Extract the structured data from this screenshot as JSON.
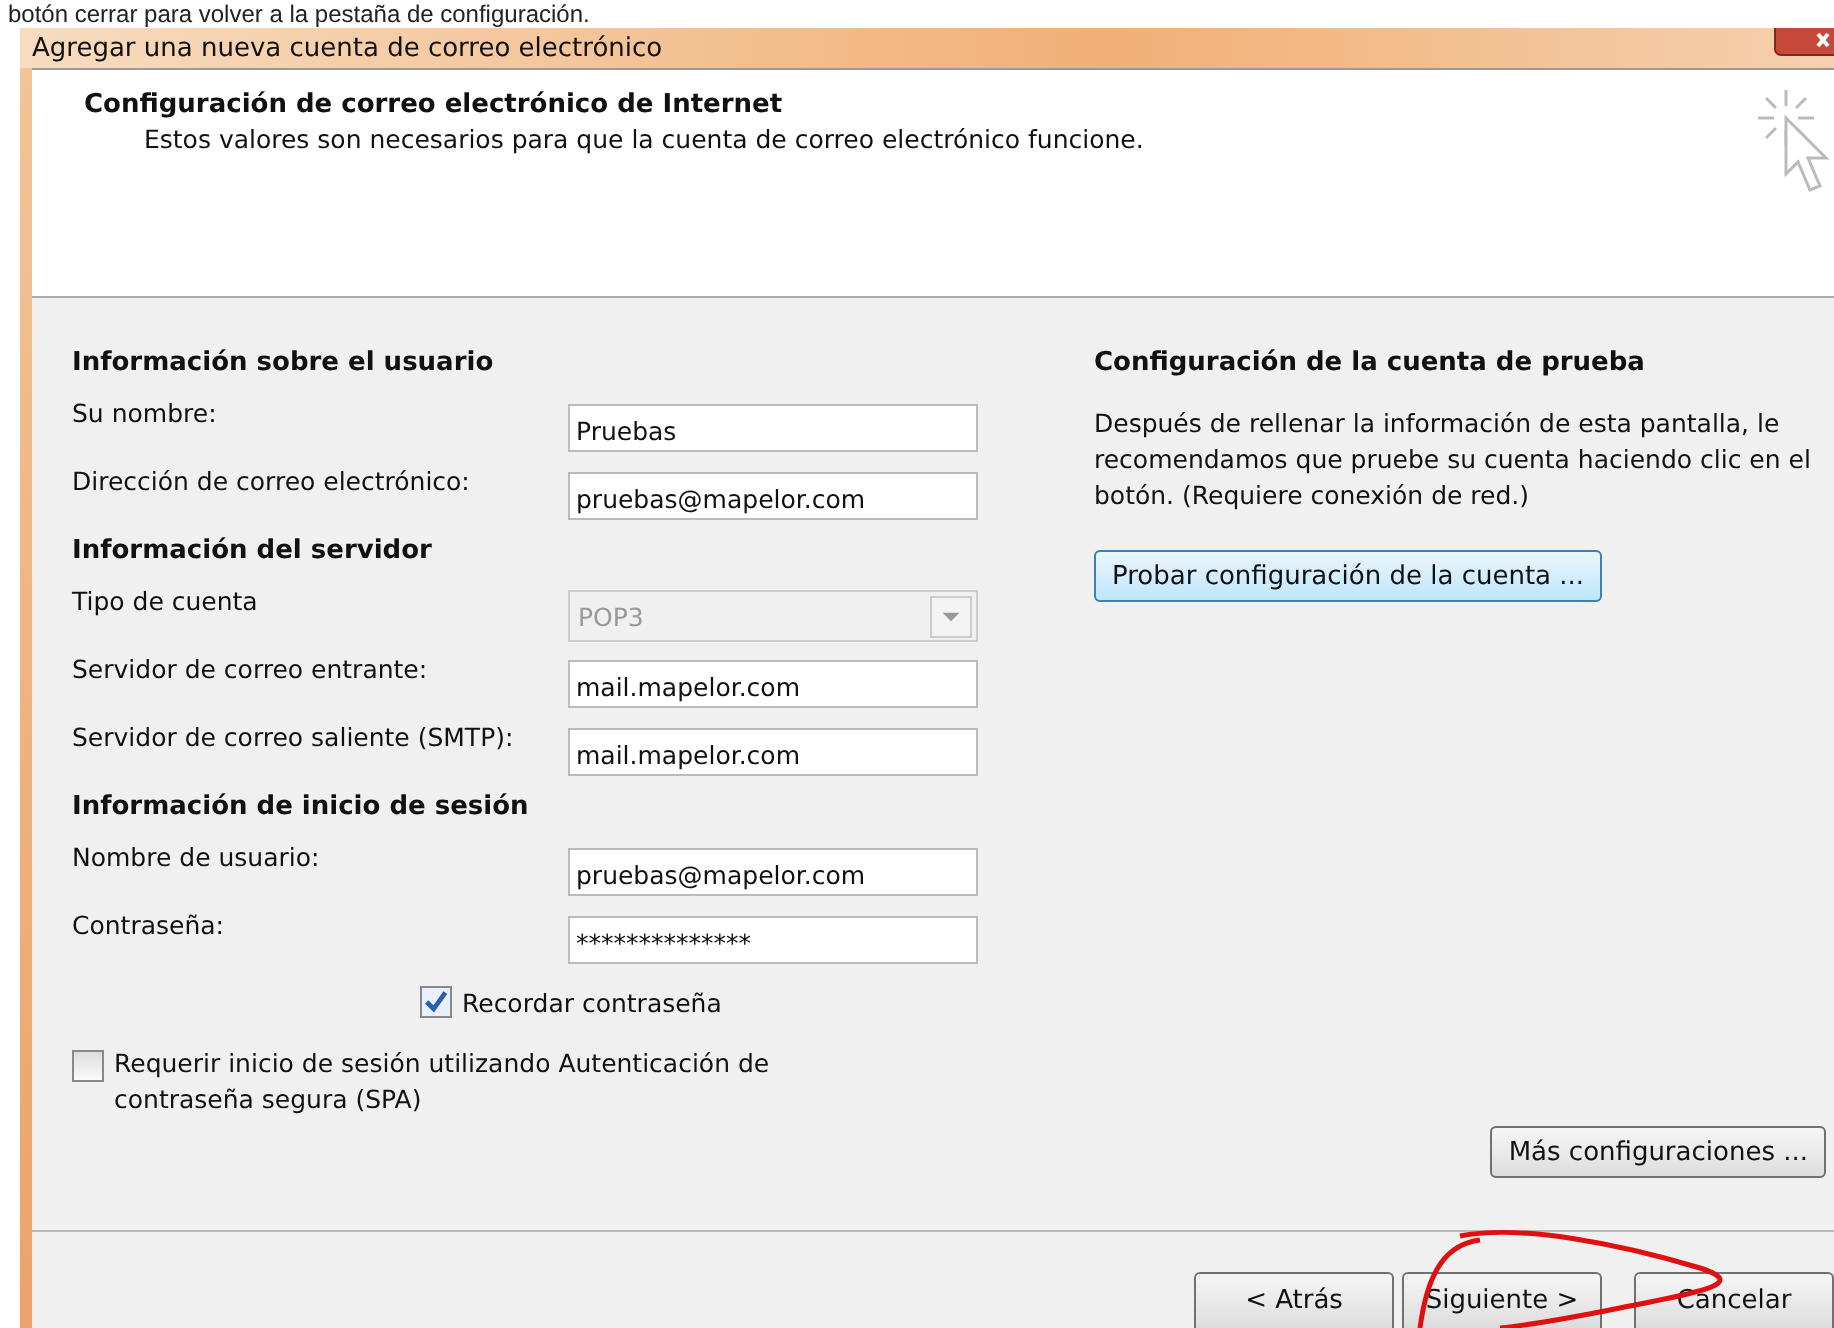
{
  "caption": "botón cerrar para volver a la pestaña de configuración.",
  "window": {
    "title": "Agregar una nueva cuenta de correo electrónico"
  },
  "header": {
    "title": "Configuración de correo electrónico de Internet",
    "subtitle": "Estos valores son necesarios para que la cuenta de correo electrónico funcione."
  },
  "sections": [
    {
      "heading": "Información sobre el usuario",
      "fields": [
        {
          "kind": "text",
          "label": "Su nombre:",
          "value": "Pruebas",
          "disabled": false
        },
        {
          "kind": "text",
          "label": "Dirección de correo electrónico:",
          "value": "pruebas@mapelor.com",
          "disabled": false
        }
      ]
    },
    {
      "heading": "Información del servidor",
      "fields": [
        {
          "kind": "dropdown",
          "label": "Tipo de cuenta",
          "value": "POP3",
          "disabled": true
        },
        {
          "kind": "text",
          "label": "Servidor de correo entrante:",
          "value": "mail.mapelor.com",
          "disabled": false
        },
        {
          "kind": "text",
          "label": "Servidor de correo saliente (SMTP):",
          "value": "mail.mapelor.com",
          "disabled": false
        }
      ]
    },
    {
      "heading": "Información de inicio de sesión",
      "fields": [
        {
          "kind": "text",
          "label": "Nombre de usuario:",
          "value": "pruebas@mapelor.com",
          "disabled": false
        },
        {
          "kind": "text",
          "label": "Contraseña:",
          "value": "**************",
          "disabled": false
        }
      ]
    }
  ],
  "remember_password": {
    "label": "Recordar contraseña",
    "checked": true
  },
  "spa": {
    "label": "Requerir inicio de sesión utilizando Autenticación de contraseña segura (SPA)",
    "checked": false
  },
  "test": {
    "heading": "Configuración de la cuenta de prueba",
    "description": "Después de rellenar la información de esta pantalla, le recomendamos que pruebe su cuenta haciendo clic en el botón. (Requiere conexión de red.)",
    "button": "Probar configuración de la cuenta ..."
  },
  "more_button": "Más configuraciones ...",
  "nav_buttons": [
    "< Atrás",
    "Siguiente >",
    "Cancelar"
  ]
}
